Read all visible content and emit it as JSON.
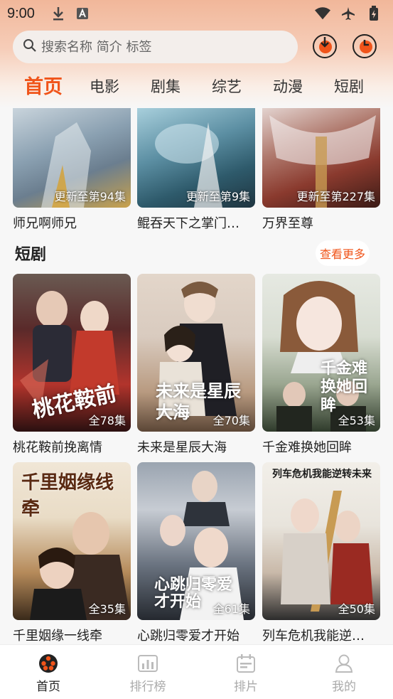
{
  "status_bar": {
    "time": "9:00"
  },
  "search": {
    "placeholder": "搜索名称 简介 标签"
  },
  "tabs": [
    {
      "label": "首页",
      "active": true
    },
    {
      "label": "电影",
      "active": false
    },
    {
      "label": "剧集",
      "active": false
    },
    {
      "label": "综艺",
      "active": false
    },
    {
      "label": "动漫",
      "active": false
    },
    {
      "label": "短剧",
      "active": false
    }
  ],
  "anime_row": [
    {
      "title": "师兄啊师兄",
      "badge": "更新至第94集",
      "poster_colors": [
        "#c9d4dc",
        "#6b7e8f",
        "#caa24b"
      ]
    },
    {
      "title": "鲲吞天下之掌门…",
      "badge": "更新至第9集",
      "poster_colors": [
        "#8fb9c8",
        "#2e5a6b",
        "#1f3540"
      ]
    },
    {
      "title": "万界至尊",
      "badge": "更新至第227集",
      "poster_colors": [
        "#d9c6c2",
        "#8a3a2e",
        "#3b1b16"
      ]
    }
  ],
  "short_section": {
    "title": "短剧",
    "more_label": "查看更多"
  },
  "short_row1": [
    {
      "title": "桃花鞍前挽离情",
      "badge": "全78集",
      "deco": "桃花鞍前",
      "poster_colors": [
        "#5a2a2a",
        "#b2342c",
        "#2a1010"
      ]
    },
    {
      "title": "未来是星辰大海",
      "badge": "全70集",
      "deco": "未来是星辰大海",
      "poster_colors": [
        "#d9cbbf",
        "#b89a80",
        "#5b4636"
      ]
    },
    {
      "title": "千金难换她回眸",
      "badge": "全53集",
      "deco": "千金难换她回眸",
      "poster_colors": [
        "#d8ddd2",
        "#9aa690",
        "#2f3b2b"
      ]
    }
  ],
  "short_row2": [
    {
      "title": "千里姻缘一线牵",
      "badge": "全35集",
      "deco": "千里姻缘线牵",
      "poster_colors": [
        "#e9dcc6",
        "#b58a5a",
        "#3a2a1a"
      ]
    },
    {
      "title": "心跳归零爱才开始",
      "badge": "全61集",
      "deco": "心跳归零爱才开始",
      "poster_colors": [
        "#c7ccd3",
        "#6a7380",
        "#25292f"
      ]
    },
    {
      "title": "列车危机我能逆…",
      "badge": "全50集",
      "deco": "列车危机我能逆转未来",
      "poster_colors": [
        "#e8e4dc",
        "#b3392a",
        "#2c2c2c"
      ]
    }
  ],
  "bottom_nav": [
    {
      "label": "首页",
      "active": true
    },
    {
      "label": "排行榜",
      "active": false
    },
    {
      "label": "排片",
      "active": false
    },
    {
      "label": "我的",
      "active": false
    }
  ],
  "colors": {
    "accent": "#f0541a",
    "header_top": "#f1b79a",
    "nav_inactive": "#aaaaaa"
  }
}
